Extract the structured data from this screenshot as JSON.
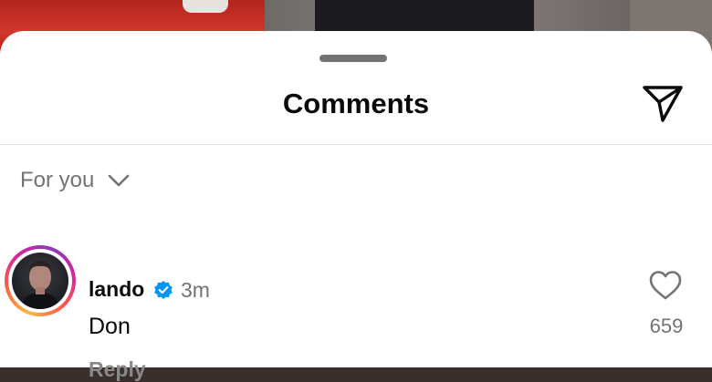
{
  "header": {
    "title": "Comments",
    "share_icon": "paper-plane-icon"
  },
  "filter": {
    "label": "For you",
    "icon": "chevron-down-icon"
  },
  "comments": [
    {
      "username": "lando",
      "verified": true,
      "time": "3m",
      "text": "Don",
      "reply_label": "Reply",
      "like_count": "659",
      "like_icon": "heart-outline-icon"
    }
  ],
  "colors": {
    "sheet_bg": "#ffffff",
    "primary_text": "#0a0a0a",
    "secondary_text": "#737373",
    "verified_blue": "#0095f6"
  }
}
